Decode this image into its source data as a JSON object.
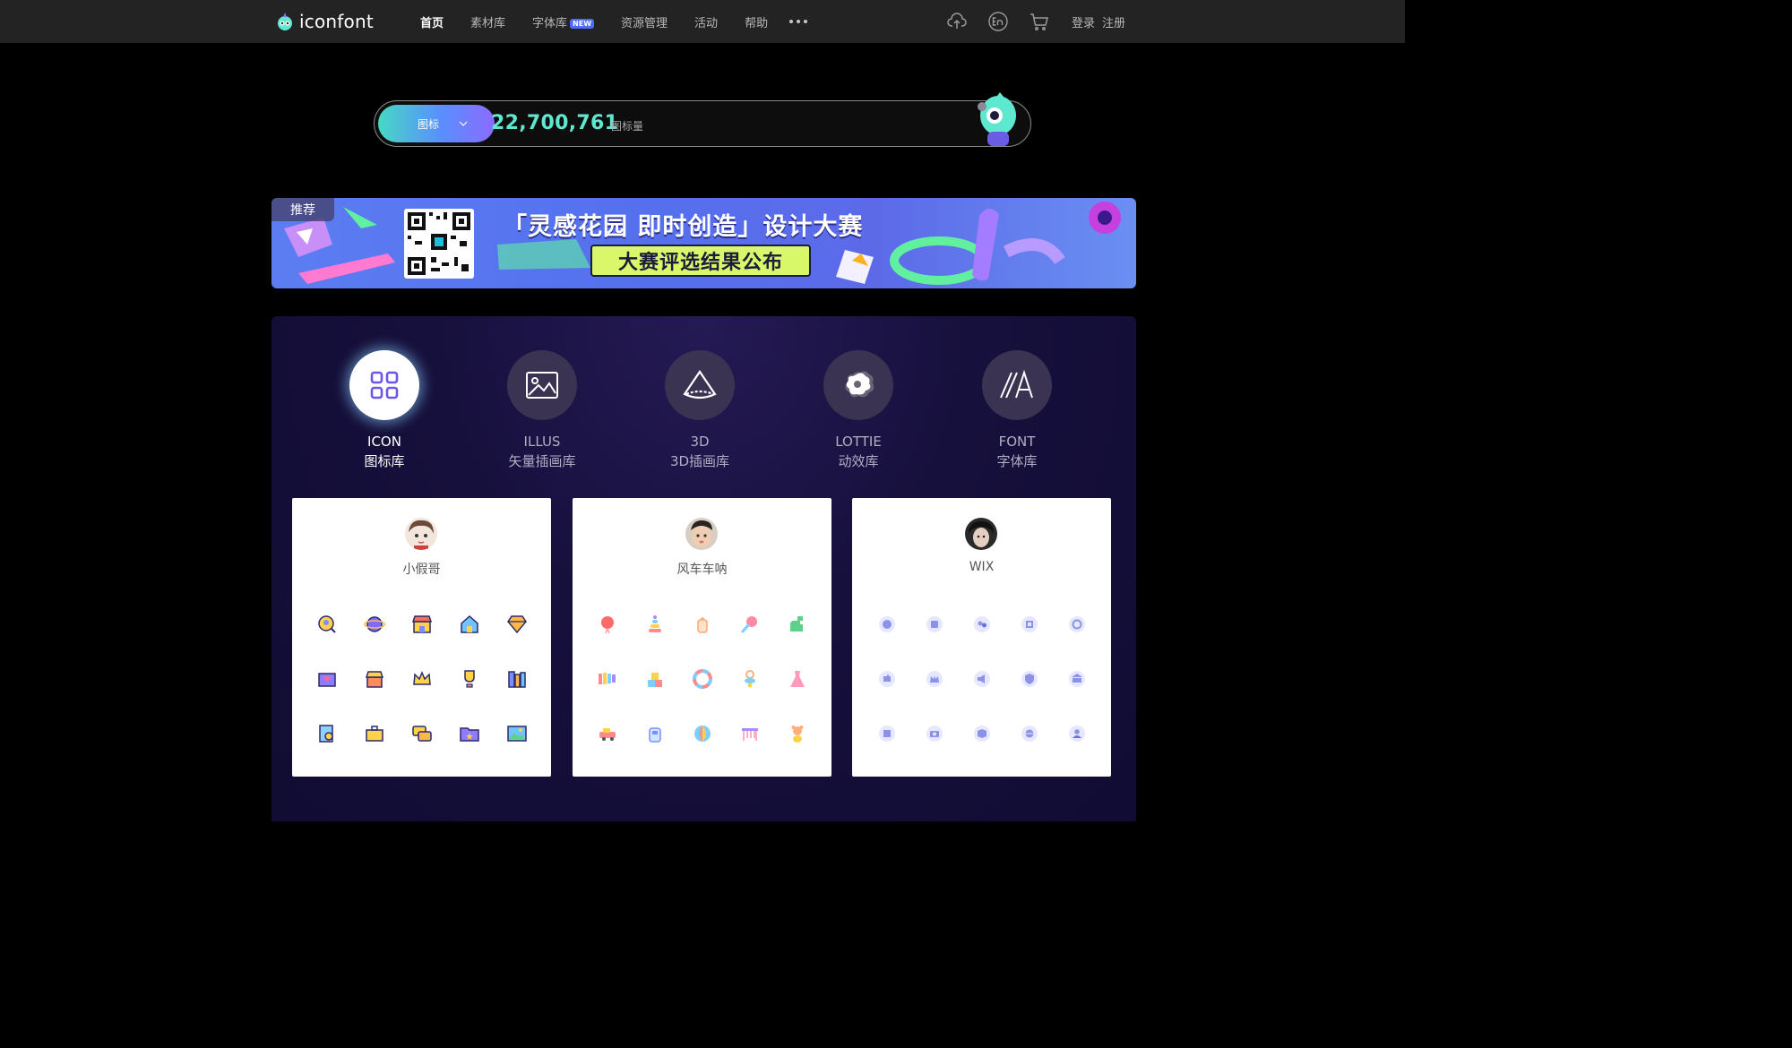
{
  "brand": {
    "name": "iconfont"
  },
  "nav": {
    "items": [
      "首页",
      "素材库",
      "字体库",
      "资源管理",
      "活动",
      "帮助"
    ],
    "active": "首页",
    "badge": "NEW"
  },
  "auth": {
    "login": "登录",
    "register": "注册"
  },
  "icons_meta": {
    "upload": "upload-icon",
    "language": "language-en-icon",
    "cart": "cart-icon"
  },
  "search": {
    "type_label": "图标",
    "count": "22,700,761",
    "count_unit": "图标量"
  },
  "banner": {
    "tag": "推荐",
    "title": "「灵感花园 即时创造」设计大赛",
    "subtitle": "大赛评选结果公布"
  },
  "categories": [
    {
      "en": "ICON",
      "cn": "图标库",
      "active": true
    },
    {
      "en": "ILLUS",
      "cn": "矢量插画库",
      "active": false
    },
    {
      "en": "3D",
      "cn": "3D插画库",
      "active": false
    },
    {
      "en": "LOTTIE",
      "cn": "动效库",
      "active": false
    },
    {
      "en": "FONT",
      "cn": "字体库",
      "active": false
    }
  ],
  "cards": [
    {
      "author": "小假哥"
    },
    {
      "author": "风车车呐"
    },
    {
      "author": "WIX"
    }
  ],
  "colors": {
    "topbar": "#232323",
    "accent_teal": "#5fe8d0",
    "accent_purple": "#8c6bff",
    "panel": "#16103c"
  }
}
